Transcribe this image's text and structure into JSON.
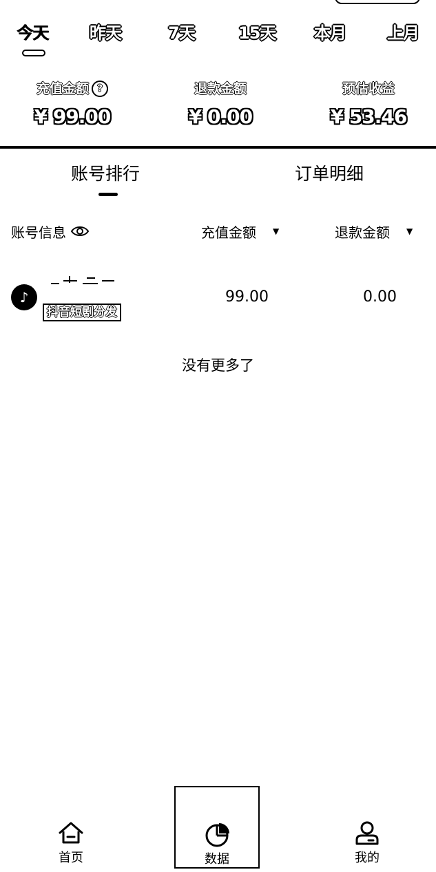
{
  "period_tabs": [
    {
      "label": "今天",
      "active": true
    },
    {
      "label": "昨天",
      "active": false
    },
    {
      "label": "7天",
      "active": false
    },
    {
      "label": "15天",
      "active": false
    },
    {
      "label": "本月",
      "active": false
    },
    {
      "label": "上月",
      "active": false
    }
  ],
  "stats": {
    "recharge": {
      "label": "充值金额",
      "value": "¥ 99.00",
      "help_icon": "question-circle-icon"
    },
    "refund": {
      "label": "退款金额",
      "value": "¥ 0.00"
    },
    "income": {
      "label": "预估收益",
      "value": "¥ 53.46"
    }
  },
  "section_tabs": [
    {
      "label": "账号排行",
      "active": true
    },
    {
      "label": "订单明细",
      "active": false
    }
  ],
  "table": {
    "headers": {
      "account": "账号信息",
      "account_icon": "eye-icon",
      "recharge": "充值金额",
      "refund": "退款金额",
      "sort_icon": "caret-down-icon"
    },
    "rows": [
      {
        "avatar_icon": "tiktok-icon",
        "tag": "抖音短剧分发",
        "recharge": "99.00",
        "refund": "0.00"
      }
    ]
  },
  "no_more": "没有更多了",
  "bottom_nav": [
    {
      "label": "首页",
      "icon": "home-icon",
      "active": false
    },
    {
      "label": "数据",
      "icon": "pie-chart-icon",
      "active": true
    },
    {
      "label": "我的",
      "icon": "user-icon",
      "active": false
    }
  ]
}
